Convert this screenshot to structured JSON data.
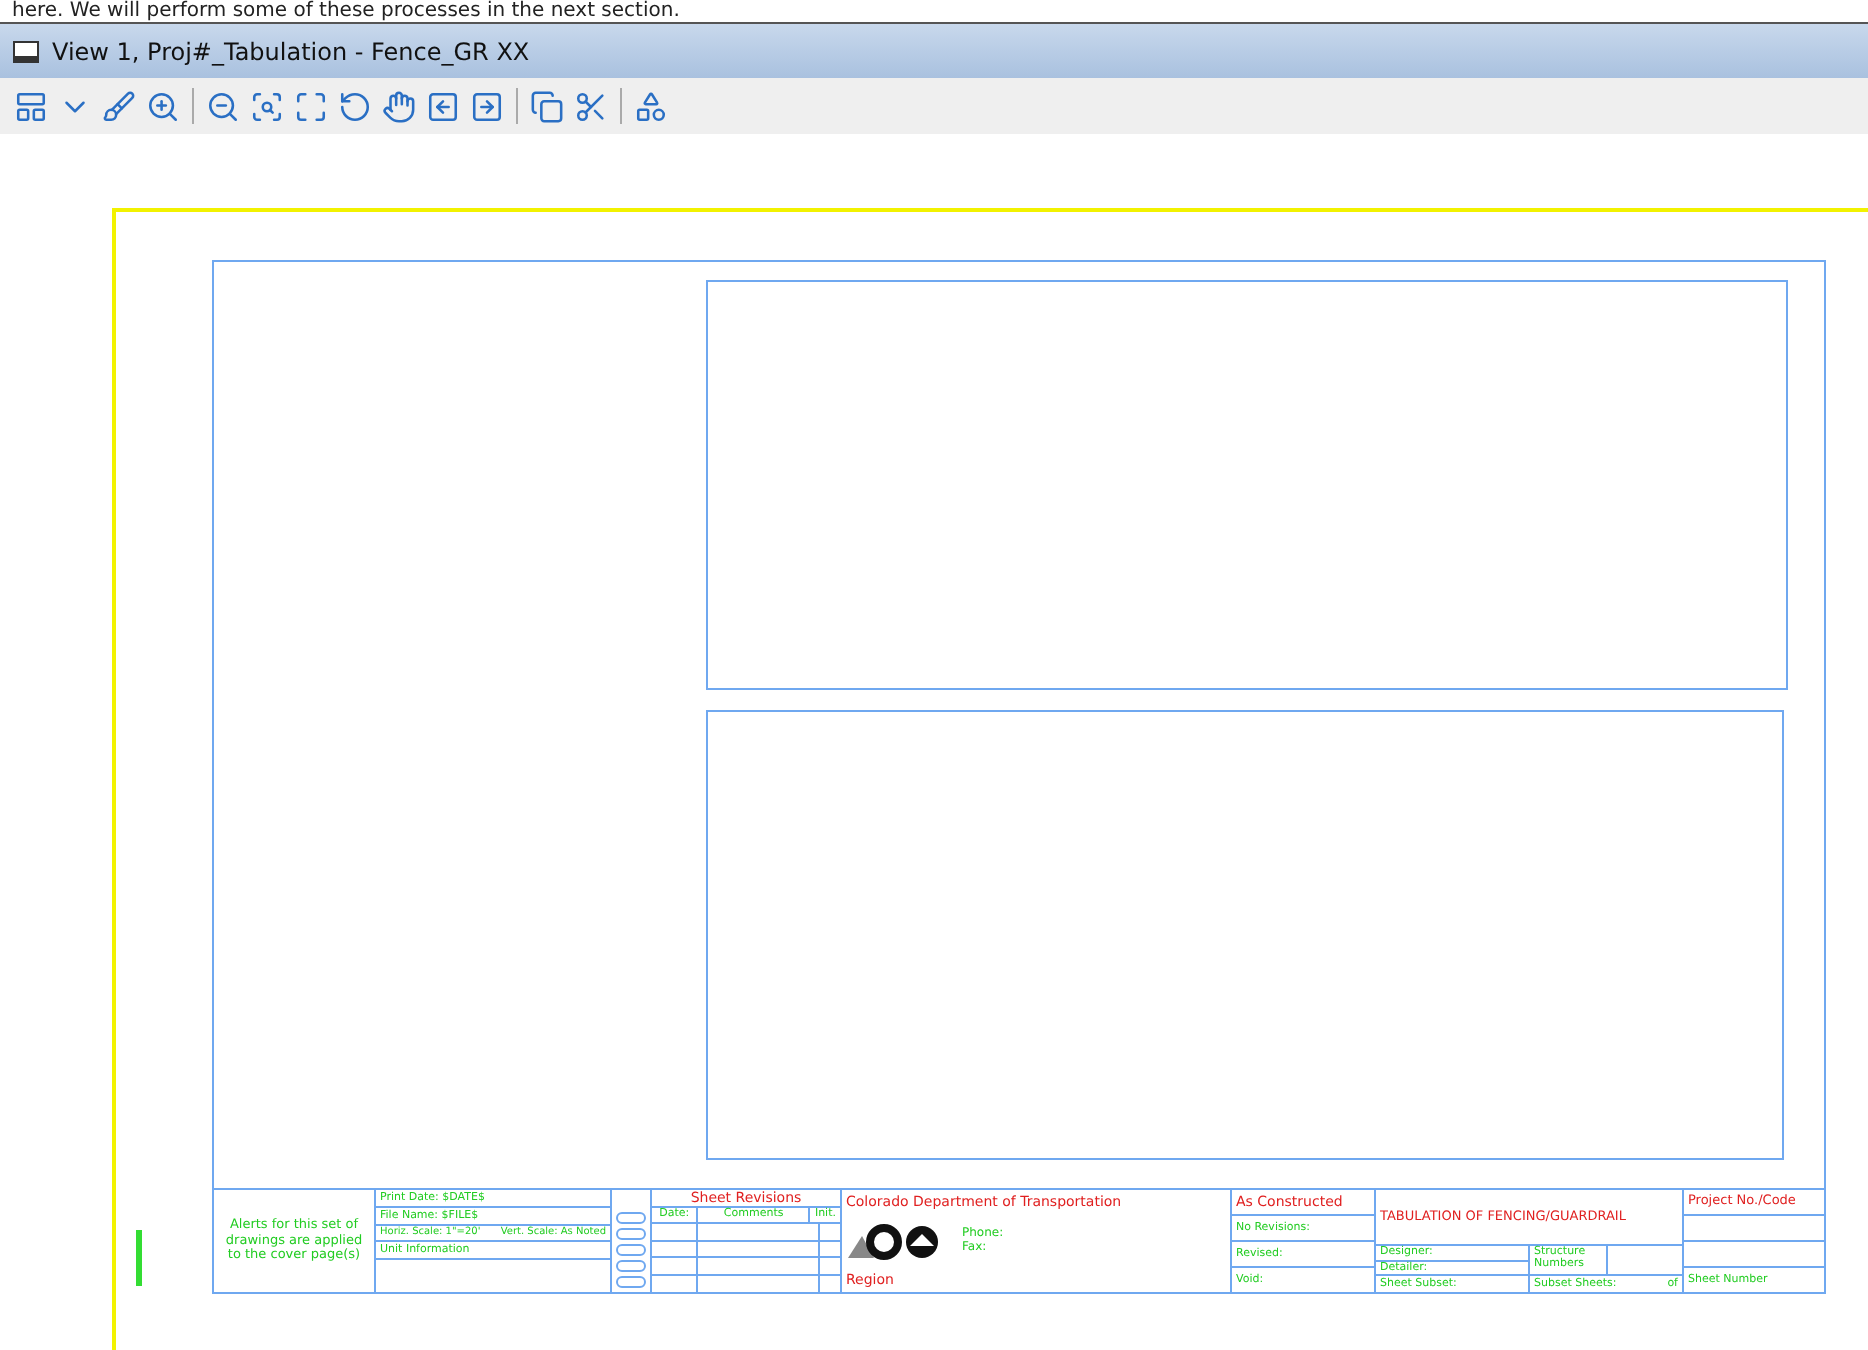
{
  "document_text": "here. We will perform some of these processes in the next section.",
  "window": {
    "title": "View 1, Proj#_Tabulation - Fence_GR XX"
  },
  "title_block": {
    "notes": "Alerts for this set of drawings are applied to the cover page(s)",
    "info": {
      "print_date": "Print Date: $DATE$",
      "file_name": "File Name: $FILE$",
      "horiz_scale": "Horiz. Scale: 1\"=20'",
      "vert_scale": "Vert. Scale: As Noted",
      "unit": "Unit Information"
    },
    "revisions": {
      "title": "Sheet Revisions",
      "columns": [
        "Date:",
        "Comments",
        "Init."
      ]
    },
    "agency": {
      "name": "Colorado Department of Transportation",
      "phone": "Phone:",
      "fax": "Fax:",
      "region": "Region"
    },
    "as_constructed": {
      "title": "As Constructed",
      "rows": [
        "No Revisions:",
        "Revised:",
        "Void:"
      ]
    },
    "sheet_title": "TABULATION OF FENCING/GUARDRAIL",
    "details": {
      "designer": "Designer:",
      "detailer": "Detailer:",
      "sheet_subset": "Sheet Subset:",
      "structure_numbers": "Structure Numbers",
      "subset_sheets": "Subset Sheets:",
      "of": "of"
    },
    "project": {
      "title": "Project No./Code",
      "sheet_number": "Sheet Number"
    }
  }
}
